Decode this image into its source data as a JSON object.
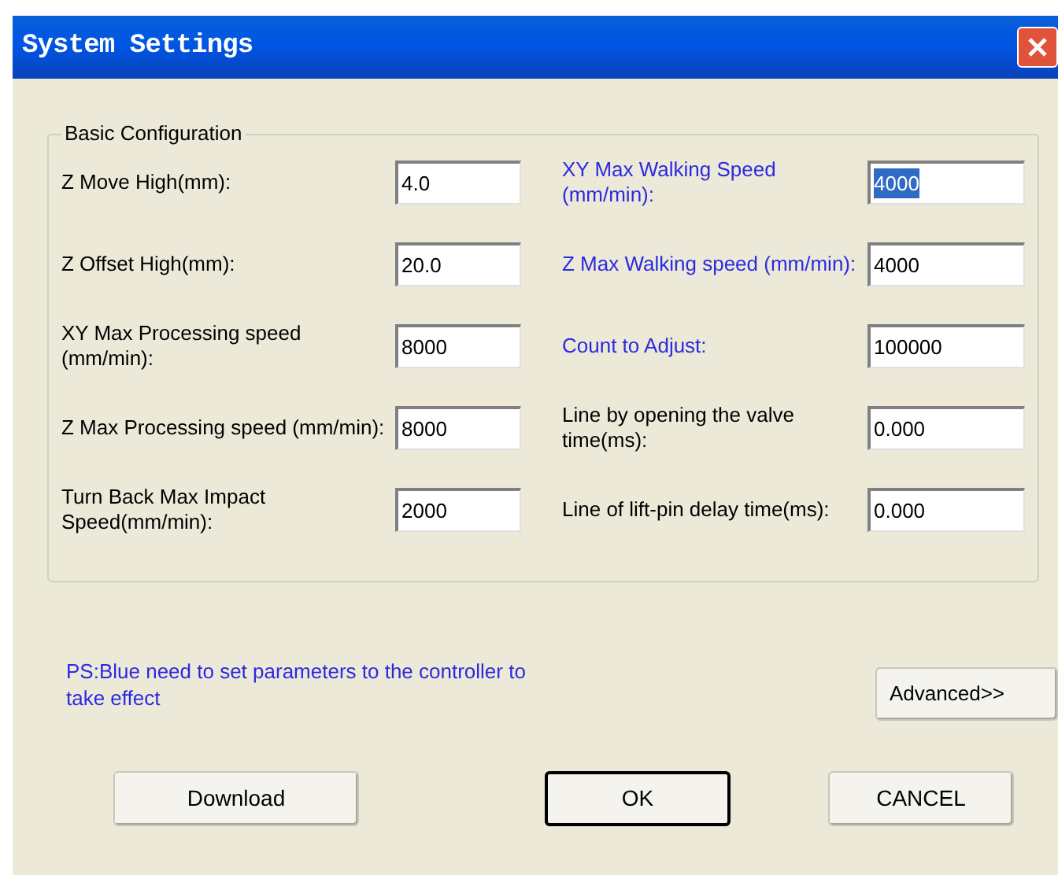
{
  "window": {
    "title": "System Settings"
  },
  "group": {
    "title": "Basic Configuration",
    "left": [
      {
        "label": "Z Move High(mm):",
        "value": "4.0",
        "controller_param": false,
        "selected": false
      },
      {
        "label": "Z Offset High(mm):",
        "value": "20.0",
        "controller_param": false,
        "selected": false
      },
      {
        "label": "XY Max Processing speed (mm/min):",
        "value": "8000",
        "controller_param": false,
        "selected": false
      },
      {
        "label": "Z Max Processing speed (mm/min):",
        "value": "8000",
        "controller_param": false,
        "selected": false
      },
      {
        "label": "Turn Back Max Impact Speed(mm/min):",
        "value": "2000",
        "controller_param": false,
        "selected": false
      }
    ],
    "right": [
      {
        "label": "XY Max Walking Speed (mm/min):",
        "value": "4000",
        "controller_param": true,
        "selected": true
      },
      {
        "label": "Z Max Walking speed (mm/min):",
        "value": "4000",
        "controller_param": true,
        "selected": false
      },
      {
        "label": "Count to Adjust:",
        "value": "100000",
        "controller_param": true,
        "selected": false
      },
      {
        "label": "Line by opening the valve time(ms):",
        "value": "0.000",
        "controller_param": false,
        "selected": false
      },
      {
        "label": "Line of lift-pin delay time(ms):",
        "value": "0.000",
        "controller_param": false,
        "selected": false
      }
    ]
  },
  "note": "PS:Blue need to set parameters to the controller to take effect",
  "advanced_button": {
    "label": "Advanced>>",
    "default": false
  },
  "buttons": [
    {
      "label": "Download",
      "default": false
    },
    {
      "label": "OK",
      "default": true
    },
    {
      "label": "CANCEL",
      "default": false
    }
  ]
}
